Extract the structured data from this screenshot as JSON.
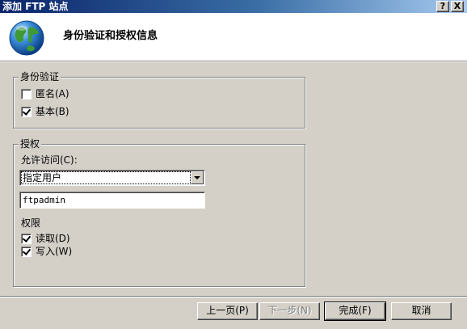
{
  "window": {
    "title": "添加 FTP 站点",
    "help_glyph": "?",
    "close_glyph": "X"
  },
  "header": {
    "title": "身份验证和授权信息",
    "icon": "globe-icon"
  },
  "authentication": {
    "legend": "身份验证",
    "anonymous": {
      "label": "匿名(A)",
      "checked": false
    },
    "basic": {
      "label": "基本(B)",
      "checked": true
    }
  },
  "authorization": {
    "legend": "授权",
    "allow_access_label": "允许访问(C):",
    "allow_access_value": "指定用户",
    "user_value": "ftpadmin",
    "permissions_label": "权限",
    "read": {
      "label": "读取(D)",
      "checked": true
    },
    "write": {
      "label": "写入(W)",
      "checked": true
    }
  },
  "buttons": {
    "back": "上一页(P)",
    "next": "下一步(N)",
    "finish": "完成(F)",
    "cancel": "取消"
  },
  "colors": {
    "title_bar_start": "#0a246a",
    "title_bar_end": "#a6caf0",
    "dialog_bg": "#d4d0c8",
    "header_bg": "#ffffff"
  }
}
